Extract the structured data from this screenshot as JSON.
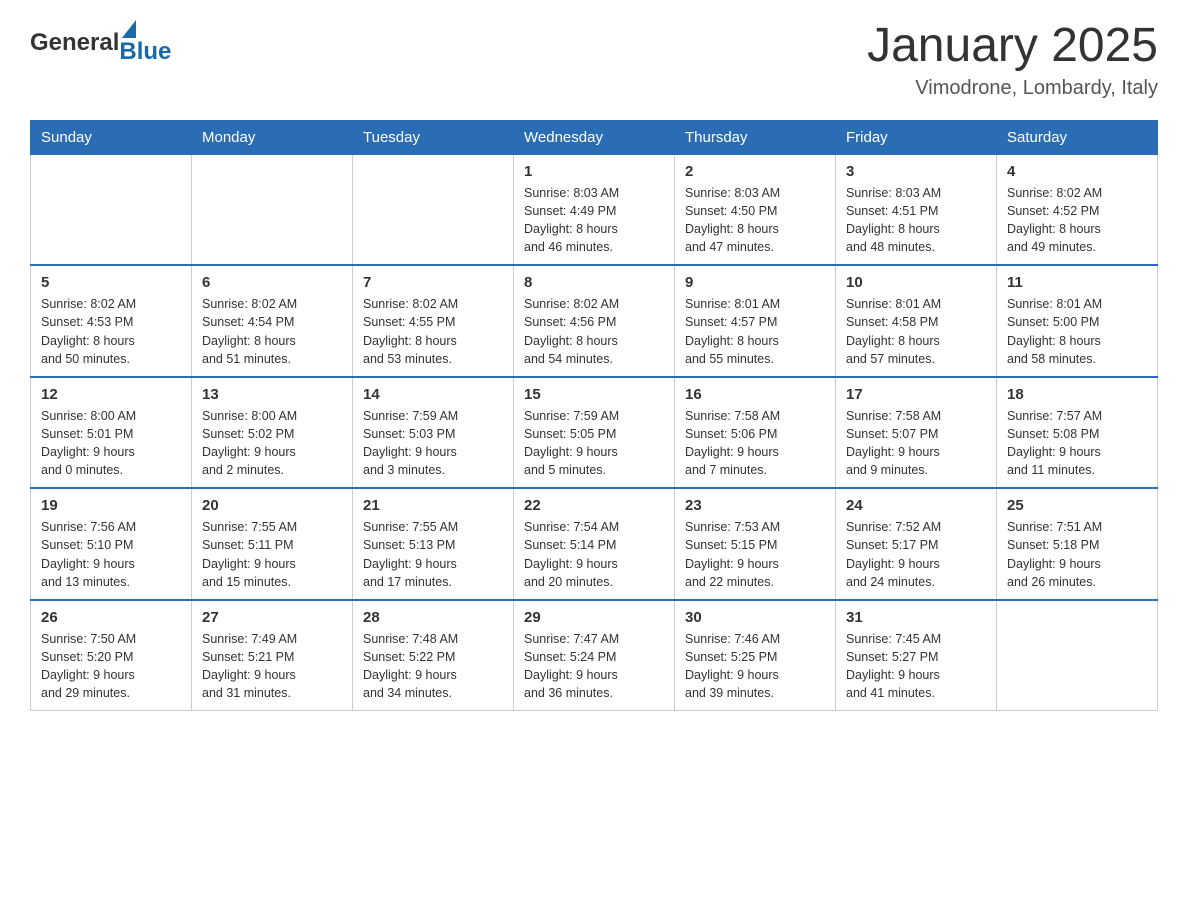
{
  "header": {
    "logo_general": "General",
    "logo_blue": "Blue",
    "month_title": "January 2025",
    "location": "Vimodrone, Lombardy, Italy"
  },
  "days_of_week": [
    "Sunday",
    "Monday",
    "Tuesday",
    "Wednesday",
    "Thursday",
    "Friday",
    "Saturday"
  ],
  "weeks": [
    [
      {
        "day": "",
        "info": ""
      },
      {
        "day": "",
        "info": ""
      },
      {
        "day": "",
        "info": ""
      },
      {
        "day": "1",
        "info": "Sunrise: 8:03 AM\nSunset: 4:49 PM\nDaylight: 8 hours\nand 46 minutes."
      },
      {
        "day": "2",
        "info": "Sunrise: 8:03 AM\nSunset: 4:50 PM\nDaylight: 8 hours\nand 47 minutes."
      },
      {
        "day": "3",
        "info": "Sunrise: 8:03 AM\nSunset: 4:51 PM\nDaylight: 8 hours\nand 48 minutes."
      },
      {
        "day": "4",
        "info": "Sunrise: 8:02 AM\nSunset: 4:52 PM\nDaylight: 8 hours\nand 49 minutes."
      }
    ],
    [
      {
        "day": "5",
        "info": "Sunrise: 8:02 AM\nSunset: 4:53 PM\nDaylight: 8 hours\nand 50 minutes."
      },
      {
        "day": "6",
        "info": "Sunrise: 8:02 AM\nSunset: 4:54 PM\nDaylight: 8 hours\nand 51 minutes."
      },
      {
        "day": "7",
        "info": "Sunrise: 8:02 AM\nSunset: 4:55 PM\nDaylight: 8 hours\nand 53 minutes."
      },
      {
        "day": "8",
        "info": "Sunrise: 8:02 AM\nSunset: 4:56 PM\nDaylight: 8 hours\nand 54 minutes."
      },
      {
        "day": "9",
        "info": "Sunrise: 8:01 AM\nSunset: 4:57 PM\nDaylight: 8 hours\nand 55 minutes."
      },
      {
        "day": "10",
        "info": "Sunrise: 8:01 AM\nSunset: 4:58 PM\nDaylight: 8 hours\nand 57 minutes."
      },
      {
        "day": "11",
        "info": "Sunrise: 8:01 AM\nSunset: 5:00 PM\nDaylight: 8 hours\nand 58 minutes."
      }
    ],
    [
      {
        "day": "12",
        "info": "Sunrise: 8:00 AM\nSunset: 5:01 PM\nDaylight: 9 hours\nand 0 minutes."
      },
      {
        "day": "13",
        "info": "Sunrise: 8:00 AM\nSunset: 5:02 PM\nDaylight: 9 hours\nand 2 minutes."
      },
      {
        "day": "14",
        "info": "Sunrise: 7:59 AM\nSunset: 5:03 PM\nDaylight: 9 hours\nand 3 minutes."
      },
      {
        "day": "15",
        "info": "Sunrise: 7:59 AM\nSunset: 5:05 PM\nDaylight: 9 hours\nand 5 minutes."
      },
      {
        "day": "16",
        "info": "Sunrise: 7:58 AM\nSunset: 5:06 PM\nDaylight: 9 hours\nand 7 minutes."
      },
      {
        "day": "17",
        "info": "Sunrise: 7:58 AM\nSunset: 5:07 PM\nDaylight: 9 hours\nand 9 minutes."
      },
      {
        "day": "18",
        "info": "Sunrise: 7:57 AM\nSunset: 5:08 PM\nDaylight: 9 hours\nand 11 minutes."
      }
    ],
    [
      {
        "day": "19",
        "info": "Sunrise: 7:56 AM\nSunset: 5:10 PM\nDaylight: 9 hours\nand 13 minutes."
      },
      {
        "day": "20",
        "info": "Sunrise: 7:55 AM\nSunset: 5:11 PM\nDaylight: 9 hours\nand 15 minutes."
      },
      {
        "day": "21",
        "info": "Sunrise: 7:55 AM\nSunset: 5:13 PM\nDaylight: 9 hours\nand 17 minutes."
      },
      {
        "day": "22",
        "info": "Sunrise: 7:54 AM\nSunset: 5:14 PM\nDaylight: 9 hours\nand 20 minutes."
      },
      {
        "day": "23",
        "info": "Sunrise: 7:53 AM\nSunset: 5:15 PM\nDaylight: 9 hours\nand 22 minutes."
      },
      {
        "day": "24",
        "info": "Sunrise: 7:52 AM\nSunset: 5:17 PM\nDaylight: 9 hours\nand 24 minutes."
      },
      {
        "day": "25",
        "info": "Sunrise: 7:51 AM\nSunset: 5:18 PM\nDaylight: 9 hours\nand 26 minutes."
      }
    ],
    [
      {
        "day": "26",
        "info": "Sunrise: 7:50 AM\nSunset: 5:20 PM\nDaylight: 9 hours\nand 29 minutes."
      },
      {
        "day": "27",
        "info": "Sunrise: 7:49 AM\nSunset: 5:21 PM\nDaylight: 9 hours\nand 31 minutes."
      },
      {
        "day": "28",
        "info": "Sunrise: 7:48 AM\nSunset: 5:22 PM\nDaylight: 9 hours\nand 34 minutes."
      },
      {
        "day": "29",
        "info": "Sunrise: 7:47 AM\nSunset: 5:24 PM\nDaylight: 9 hours\nand 36 minutes."
      },
      {
        "day": "30",
        "info": "Sunrise: 7:46 AM\nSunset: 5:25 PM\nDaylight: 9 hours\nand 39 minutes."
      },
      {
        "day": "31",
        "info": "Sunrise: 7:45 AM\nSunset: 5:27 PM\nDaylight: 9 hours\nand 41 minutes."
      },
      {
        "day": "",
        "info": ""
      }
    ]
  ]
}
